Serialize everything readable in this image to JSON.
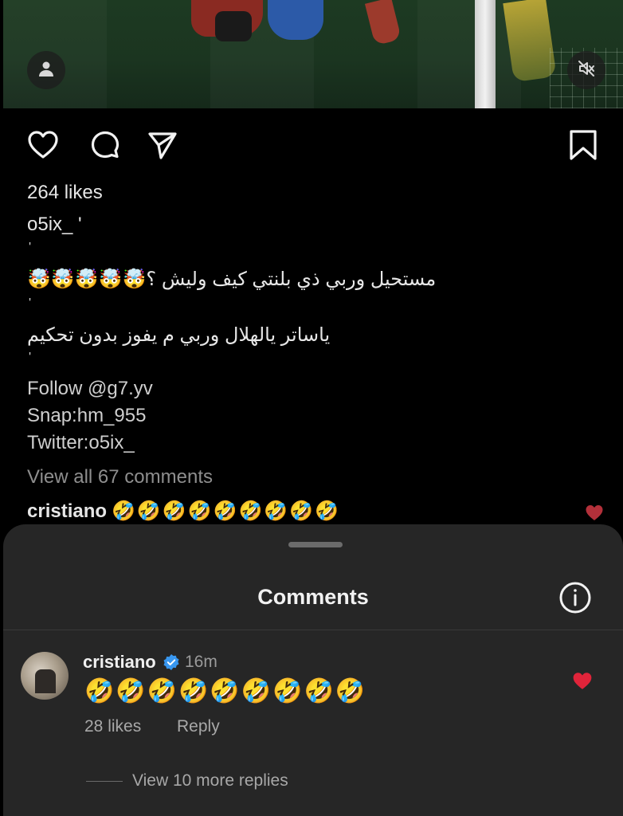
{
  "post": {
    "likes": "264 likes",
    "username": "o5ix_ '",
    "tick1": "'",
    "line1": "مستحيل وربي ذي بلنتي كيف وليش ؟🤯🤯🤯🤯🤯",
    "tick2": "'",
    "line2": "ياساتر يالهلال وربي م يفوز بدون تحكيم",
    "tick3": "'",
    "follow": "Follow @g7.yv",
    "snap": "Snap:hm_955",
    "twitter": "Twitter:o5ix_",
    "view_all": "View all 67 comments",
    "preview_user": "cristiano",
    "preview_text": "🤣🤣🤣🤣🤣🤣🤣🤣🤣"
  },
  "icons": {
    "user_tag": "person-icon",
    "mute": "speaker-muted-icon",
    "like": "heart-outline-icon",
    "comment": "comment-bubble-icon",
    "share": "paper-plane-icon",
    "save": "bookmark-icon",
    "info": "info-icon",
    "verified": "verified-badge-icon",
    "liked": "heart-filled-icon"
  },
  "colors": {
    "background": "#000000",
    "sheet": "#262626",
    "heart": "#e0243a",
    "verified": "#3897f0"
  },
  "sheet": {
    "title": "Comments",
    "comment": {
      "user": "cristiano",
      "time": "16m",
      "text": "🤣🤣🤣🤣🤣🤣🤣🤣🤣",
      "likes": "28 likes",
      "reply": "Reply"
    },
    "view_replies": "View 10 more replies"
  }
}
